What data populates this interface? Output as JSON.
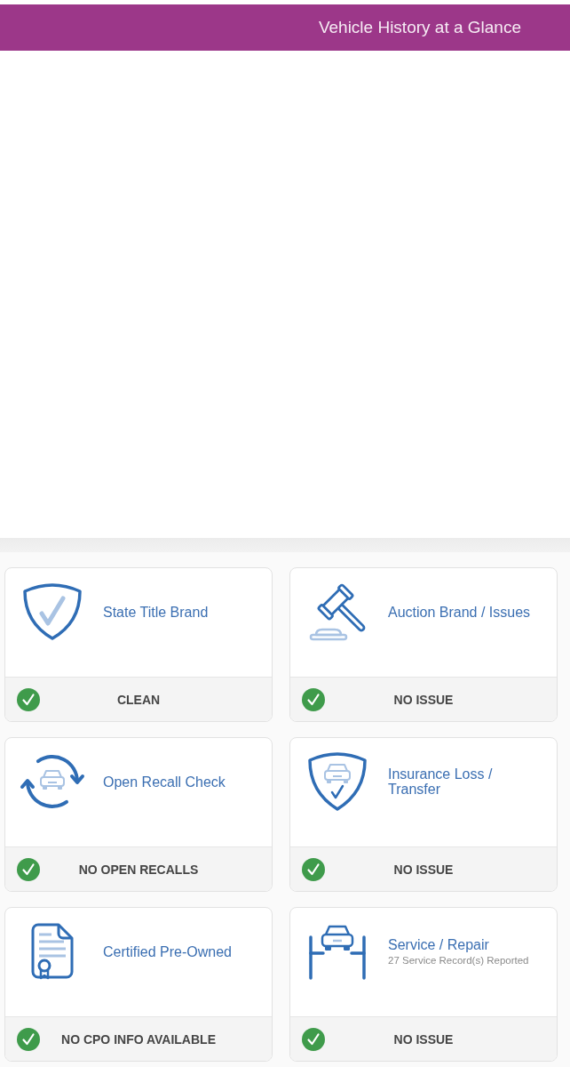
{
  "header": {
    "title": "Vehicle History at a Glance"
  },
  "cards": [
    {
      "kind": "title-brand",
      "title": "State Title Brand",
      "status": {
        "ok": true,
        "label": "CLEAN"
      }
    },
    {
      "kind": "auction",
      "title": "Auction Brand / Issues",
      "status": {
        "ok": true,
        "label": "NO ISSUE"
      }
    },
    {
      "kind": "recall",
      "title": "Open Recall Check",
      "status": {
        "ok": true,
        "label": "NO OPEN RECALLS"
      }
    },
    {
      "kind": "insurance",
      "title": "Insurance Loss / Transfer",
      "status": {
        "ok": true,
        "label": "NO ISSUE"
      }
    },
    {
      "kind": "cpo",
      "title": "Certified Pre-Owned",
      "status": {
        "ok": true,
        "label": "NO CPO INFO AVAILABLE"
      }
    },
    {
      "kind": "service",
      "title": "Service / Repair",
      "subtitle": "27 Service Record(s) Reported",
      "status": {
        "ok": true,
        "label": "NO ISSUE"
      }
    }
  ]
}
